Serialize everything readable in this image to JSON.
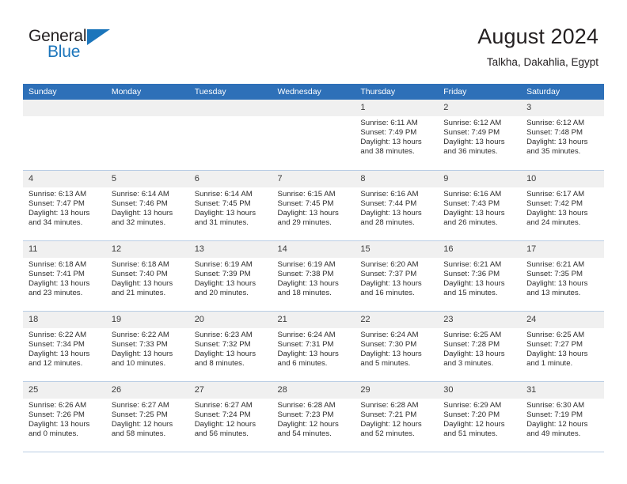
{
  "logo": {
    "line1": "General",
    "line2": "Blue",
    "triangle_icon": "triangle-icon",
    "color_dark": "#231f20",
    "color_blue": "#1b75bb"
  },
  "header": {
    "title": "August 2024",
    "location": "Talkha, Dakahlia, Egypt"
  },
  "colors": {
    "header_blue": "#2e70b8",
    "daynum_band": "#f0f0f0",
    "grid_line": "#b9cde4"
  },
  "weekday_headers": [
    "Sunday",
    "Monday",
    "Tuesday",
    "Wednesday",
    "Thursday",
    "Friday",
    "Saturday"
  ],
  "weeks": [
    [
      {
        "day": "",
        "empty": true
      },
      {
        "day": "",
        "empty": true
      },
      {
        "day": "",
        "empty": true
      },
      {
        "day": "",
        "empty": true
      },
      {
        "day": "1",
        "sunrise": "Sunrise: 6:11 AM",
        "sunset": "Sunset: 7:49 PM",
        "daylight1": "Daylight: 13 hours",
        "daylight2": "and 38 minutes."
      },
      {
        "day": "2",
        "sunrise": "Sunrise: 6:12 AM",
        "sunset": "Sunset: 7:49 PM",
        "daylight1": "Daylight: 13 hours",
        "daylight2": "and 36 minutes."
      },
      {
        "day": "3",
        "sunrise": "Sunrise: 6:12 AM",
        "sunset": "Sunset: 7:48 PM",
        "daylight1": "Daylight: 13 hours",
        "daylight2": "and 35 minutes."
      }
    ],
    [
      {
        "day": "4",
        "sunrise": "Sunrise: 6:13 AM",
        "sunset": "Sunset: 7:47 PM",
        "daylight1": "Daylight: 13 hours",
        "daylight2": "and 34 minutes."
      },
      {
        "day": "5",
        "sunrise": "Sunrise: 6:14 AM",
        "sunset": "Sunset: 7:46 PM",
        "daylight1": "Daylight: 13 hours",
        "daylight2": "and 32 minutes."
      },
      {
        "day": "6",
        "sunrise": "Sunrise: 6:14 AM",
        "sunset": "Sunset: 7:45 PM",
        "daylight1": "Daylight: 13 hours",
        "daylight2": "and 31 minutes."
      },
      {
        "day": "7",
        "sunrise": "Sunrise: 6:15 AM",
        "sunset": "Sunset: 7:45 PM",
        "daylight1": "Daylight: 13 hours",
        "daylight2": "and 29 minutes."
      },
      {
        "day": "8",
        "sunrise": "Sunrise: 6:16 AM",
        "sunset": "Sunset: 7:44 PM",
        "daylight1": "Daylight: 13 hours",
        "daylight2": "and 28 minutes."
      },
      {
        "day": "9",
        "sunrise": "Sunrise: 6:16 AM",
        "sunset": "Sunset: 7:43 PM",
        "daylight1": "Daylight: 13 hours",
        "daylight2": "and 26 minutes."
      },
      {
        "day": "10",
        "sunrise": "Sunrise: 6:17 AM",
        "sunset": "Sunset: 7:42 PM",
        "daylight1": "Daylight: 13 hours",
        "daylight2": "and 24 minutes."
      }
    ],
    [
      {
        "day": "11",
        "sunrise": "Sunrise: 6:18 AM",
        "sunset": "Sunset: 7:41 PM",
        "daylight1": "Daylight: 13 hours",
        "daylight2": "and 23 minutes."
      },
      {
        "day": "12",
        "sunrise": "Sunrise: 6:18 AM",
        "sunset": "Sunset: 7:40 PM",
        "daylight1": "Daylight: 13 hours",
        "daylight2": "and 21 minutes."
      },
      {
        "day": "13",
        "sunrise": "Sunrise: 6:19 AM",
        "sunset": "Sunset: 7:39 PM",
        "daylight1": "Daylight: 13 hours",
        "daylight2": "and 20 minutes."
      },
      {
        "day": "14",
        "sunrise": "Sunrise: 6:19 AM",
        "sunset": "Sunset: 7:38 PM",
        "daylight1": "Daylight: 13 hours",
        "daylight2": "and 18 minutes."
      },
      {
        "day": "15",
        "sunrise": "Sunrise: 6:20 AM",
        "sunset": "Sunset: 7:37 PM",
        "daylight1": "Daylight: 13 hours",
        "daylight2": "and 16 minutes."
      },
      {
        "day": "16",
        "sunrise": "Sunrise: 6:21 AM",
        "sunset": "Sunset: 7:36 PM",
        "daylight1": "Daylight: 13 hours",
        "daylight2": "and 15 minutes."
      },
      {
        "day": "17",
        "sunrise": "Sunrise: 6:21 AM",
        "sunset": "Sunset: 7:35 PM",
        "daylight1": "Daylight: 13 hours",
        "daylight2": "and 13 minutes."
      }
    ],
    [
      {
        "day": "18",
        "sunrise": "Sunrise: 6:22 AM",
        "sunset": "Sunset: 7:34 PM",
        "daylight1": "Daylight: 13 hours",
        "daylight2": "and 12 minutes."
      },
      {
        "day": "19",
        "sunrise": "Sunrise: 6:22 AM",
        "sunset": "Sunset: 7:33 PM",
        "daylight1": "Daylight: 13 hours",
        "daylight2": "and 10 minutes."
      },
      {
        "day": "20",
        "sunrise": "Sunrise: 6:23 AM",
        "sunset": "Sunset: 7:32 PM",
        "daylight1": "Daylight: 13 hours",
        "daylight2": "and 8 minutes."
      },
      {
        "day": "21",
        "sunrise": "Sunrise: 6:24 AM",
        "sunset": "Sunset: 7:31 PM",
        "daylight1": "Daylight: 13 hours",
        "daylight2": "and 6 minutes."
      },
      {
        "day": "22",
        "sunrise": "Sunrise: 6:24 AM",
        "sunset": "Sunset: 7:30 PM",
        "daylight1": "Daylight: 13 hours",
        "daylight2": "and 5 minutes."
      },
      {
        "day": "23",
        "sunrise": "Sunrise: 6:25 AM",
        "sunset": "Sunset: 7:28 PM",
        "daylight1": "Daylight: 13 hours",
        "daylight2": "and 3 minutes."
      },
      {
        "day": "24",
        "sunrise": "Sunrise: 6:25 AM",
        "sunset": "Sunset: 7:27 PM",
        "daylight1": "Daylight: 13 hours",
        "daylight2": "and 1 minute."
      }
    ],
    [
      {
        "day": "25",
        "sunrise": "Sunrise: 6:26 AM",
        "sunset": "Sunset: 7:26 PM",
        "daylight1": "Daylight: 13 hours",
        "daylight2": "and 0 minutes."
      },
      {
        "day": "26",
        "sunrise": "Sunrise: 6:27 AM",
        "sunset": "Sunset: 7:25 PM",
        "daylight1": "Daylight: 12 hours",
        "daylight2": "and 58 minutes."
      },
      {
        "day": "27",
        "sunrise": "Sunrise: 6:27 AM",
        "sunset": "Sunset: 7:24 PM",
        "daylight1": "Daylight: 12 hours",
        "daylight2": "and 56 minutes."
      },
      {
        "day": "28",
        "sunrise": "Sunrise: 6:28 AM",
        "sunset": "Sunset: 7:23 PM",
        "daylight1": "Daylight: 12 hours",
        "daylight2": "and 54 minutes."
      },
      {
        "day": "29",
        "sunrise": "Sunrise: 6:28 AM",
        "sunset": "Sunset: 7:21 PM",
        "daylight1": "Daylight: 12 hours",
        "daylight2": "and 52 minutes."
      },
      {
        "day": "30",
        "sunrise": "Sunrise: 6:29 AM",
        "sunset": "Sunset: 7:20 PM",
        "daylight1": "Daylight: 12 hours",
        "daylight2": "and 51 minutes."
      },
      {
        "day": "31",
        "sunrise": "Sunrise: 6:30 AM",
        "sunset": "Sunset: 7:19 PM",
        "daylight1": "Daylight: 12 hours",
        "daylight2": "and 49 minutes."
      }
    ]
  ]
}
